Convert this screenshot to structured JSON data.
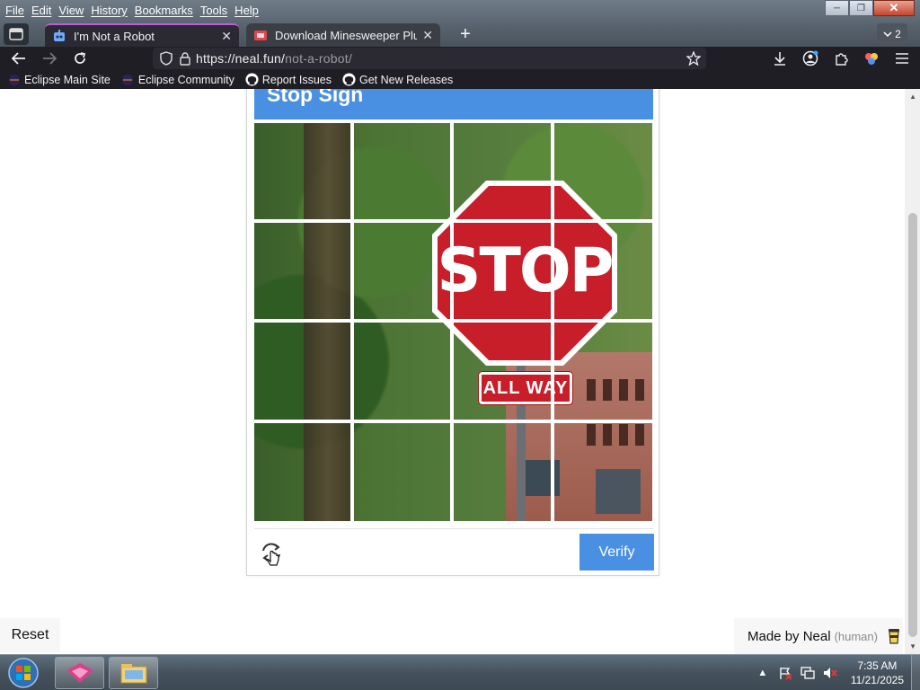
{
  "window": {
    "menu": [
      "File",
      "Edit",
      "View",
      "History",
      "Bookmarks",
      "Tools",
      "Help"
    ],
    "tabs": [
      {
        "label": "I'm Not a Robot",
        "active": true
      },
      {
        "label": "Download Minesweeper Plus by",
        "active": false
      }
    ],
    "tab_count": "2",
    "url_host": "https://neal.fun/",
    "url_path": "not-a-robot/",
    "bookmarks": [
      "Eclipse Main Site",
      "Eclipse Community",
      "Report Issues",
      "Get New Releases"
    ]
  },
  "captcha": {
    "header": "Stop Sign",
    "verify_label": "Verify",
    "sign_text": "STOP",
    "sign_subtext": "ALL WAY",
    "grid_rows": 4,
    "grid_cols": 4
  },
  "page": {
    "reset_label": "Reset",
    "made_by": "Made by Neal",
    "made_by_sub": "(human)"
  },
  "taskbar": {
    "time": "7:35 AM",
    "date": "11/21/2025"
  },
  "colors": {
    "accent": "#4a90e2",
    "stop_red": "#c71e2a",
    "tab_highlight": "#c35bd6"
  }
}
